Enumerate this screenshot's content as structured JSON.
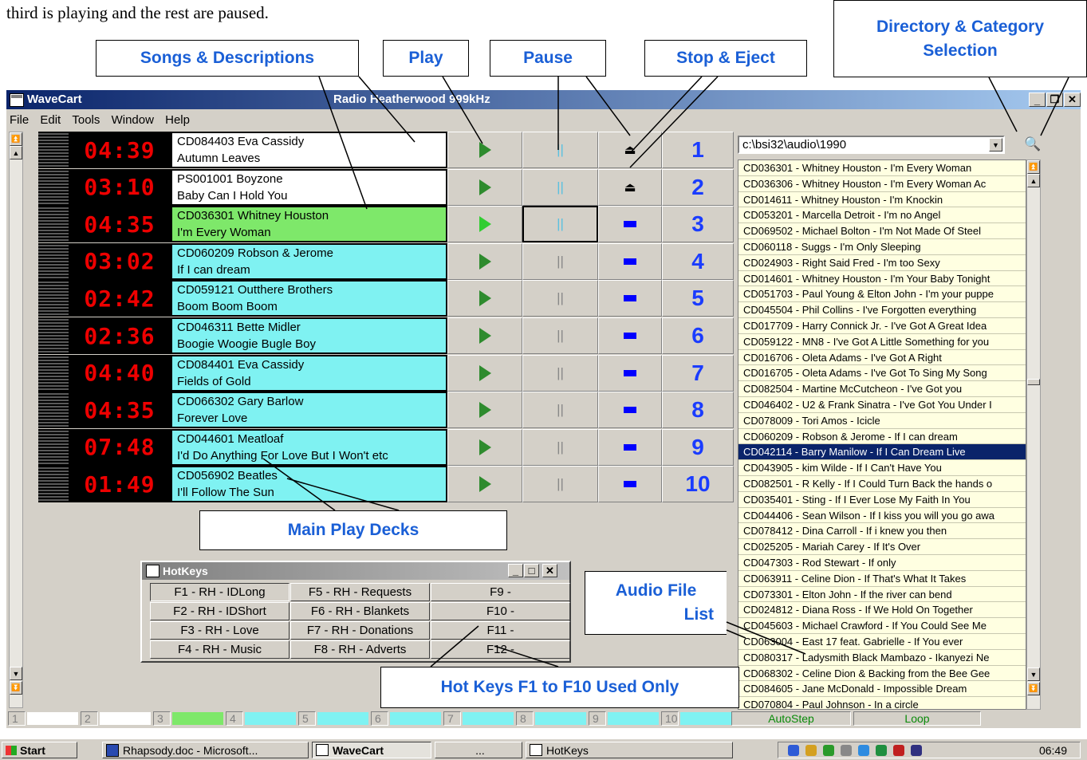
{
  "doc": {
    "text": "third is playing and the rest are paused."
  },
  "callouts": {
    "songs": "Songs & Descriptions",
    "play": "Play",
    "pause": "Pause",
    "stop": "Stop & Eject",
    "dir_line1": "Directory & Category",
    "dir_line2": "Selection",
    "main_decks": "Main Play Decks",
    "audio_line1": "Audio File",
    "audio_line2": "List",
    "hotkeys_used": "Hot Keys F1 to F10 Used Only"
  },
  "window": {
    "app_title": "WaveCart",
    "station": "Radio Heatherwood 999kHz"
  },
  "menu": [
    "File",
    "Edit",
    "Tools",
    "Window",
    "Help"
  ],
  "decks": [
    {
      "time": "04:39",
      "code": "CD084403  Eva Cassidy",
      "title": "Autumn Leaves",
      "color": "#ffffff",
      "state": "eject",
      "num": "1"
    },
    {
      "time": "03:10",
      "code": "PS001001  Boyzone",
      "title": "Baby Can I Hold You",
      "color": "#ffffff",
      "state": "eject",
      "num": "2"
    },
    {
      "time": "04:35",
      "code": "CD036301  Whitney Houston",
      "title": "I'm Every Woman",
      "color": "#7ee86a",
      "state": "playing",
      "num": "3"
    },
    {
      "time": "03:02",
      "code": "CD060209  Robson & Jerome",
      "title": "If I can dream",
      "color": "#7ff2f2",
      "state": "paused",
      "num": "4"
    },
    {
      "time": "02:42",
      "code": "CD059121  Outthere Brothers",
      "title": "Boom Boom Boom",
      "color": "#7ff2f2",
      "state": "paused",
      "num": "5"
    },
    {
      "time": "02:36",
      "code": "CD046311  Bette Midler",
      "title": "Boogie Woogie Bugle Boy",
      "color": "#7ff2f2",
      "state": "paused",
      "num": "6"
    },
    {
      "time": "04:40",
      "code": "CD084401  Eva Cassidy",
      "title": "Fields of Gold",
      "color": "#7ff2f2",
      "state": "paused",
      "num": "7"
    },
    {
      "time": "04:35",
      "code": "CD066302  Gary Barlow",
      "title": "Forever Love",
      "color": "#7ff2f2",
      "state": "paused",
      "num": "8"
    },
    {
      "time": "07:48",
      "code": "CD044601  Meatloaf",
      "title": "I'd Do Anything For Love But I Won't etc",
      "color": "#7ff2f2",
      "state": "paused",
      "num": "9"
    },
    {
      "time": "01:49",
      "code": "CD056902  Beatles",
      "title": "I'll Follow The Sun",
      "color": "#7ff2f2",
      "state": "paused",
      "num": "10"
    }
  ],
  "directory": {
    "path": "c:\\bsi32\\audio\\1990"
  },
  "files": [
    "CD036301 - Whitney Houston - I'm Every Woman",
    "CD036306 - Whitney Houston - I'm Every Woman Ac",
    "CD014611 - Whitney Houston - I'm Knockin",
    "CD053201 - Marcella Detroit - I'm no Angel",
    "CD069502 - Michael Bolton - I'm Not Made Of Steel",
    "CD060118 - Suggs - I'm Only Sleeping",
    "CD024903 - Right Said Fred - I'm too Sexy",
    "CD014601 - Whitney Houston - I'm Your Baby Tonight",
    "CD051703 - Paul Young & Elton John - I'm your puppe",
    "CD045504 - Phil Collins - I've Forgotten everything",
    "CD017709 - Harry Connick Jr. - I've Got A Great Idea",
    "CD059122 - MN8 - I've Got A Little Something for you",
    "CD016706 - Oleta Adams - I've Got A Right",
    "CD016705 - Oleta Adams - I've Got To Sing My Song",
    "CD082504 - Martine McCutcheon - I've Got you",
    "CD046402 - U2 & Frank Sinatra - I've Got You Under I",
    "CD078009 - Tori Amos - Icicle",
    "CD060209 - Robson & Jerome - If I can dream",
    "CD042114 - Barry Manilow - If I Can Dream Live",
    "CD043905 - kim Wilde - If I Can't Have You",
    "CD082501 - R Kelly - If I Could Turn Back the hands o",
    "CD035401 - Sting - If I Ever Lose My Faith In You",
    "CD044406 - Sean Wilson - If I kiss you will you go awa",
    "CD078412 - Dina Carroll - If i knew you then",
    "CD025205 - Mariah Carey - If It's Over",
    "CD047303 - Rod Stewart - If only",
    "CD063911 - Celine Dion - If That's What It Takes",
    "CD073301 - Elton John - If the river can bend",
    "CD024812 - Diana Ross - If We Hold On Together",
    "CD045603 - Michael Crawford - If You Could See Me",
    "CD063004 - East 17 feat. Gabrielle - If You ever",
    "CD080317 - Ladysmith Black Mambazo - Ikanyezi Ne",
    "CD068302 - Celine Dion & Backing from the Bee Gee",
    "CD084605 - Jane McDonald - Impossible Dream",
    "CD070804 - Paul Johnson - In a circle"
  ],
  "selected_file_index": 18,
  "hotkeys": {
    "title": "HotKeys",
    "buttons": [
      "F1 - RH - IDLong",
      "F5 - RH - Requests",
      "F9 -",
      "F2 - RH - IDShort",
      "F6 - RH - Blankets",
      "F10 -",
      "F3 - RH - Love",
      "F7 - RH - Donations",
      "F11 -",
      "F4 - RH - Music",
      "F8 - RH - Adverts",
      "F12 -"
    ]
  },
  "status": {
    "slots": [
      "1",
      "2",
      "3",
      "4",
      "5",
      "6",
      "7",
      "8",
      "9",
      "10"
    ],
    "autostep": "AutoStep",
    "loop": "Loop"
  },
  "taskbar": {
    "start": "Start",
    "items": [
      "Rhapsody.doc - Microsoft...",
      "WaveCart",
      "...",
      "HotKeys"
    ],
    "clock": "06:49"
  },
  "colors": {
    "playing": "#7ee86a",
    "paused": "#7ff2f2",
    "timer": "#ff0000",
    "accent": "#1a5fd6"
  }
}
